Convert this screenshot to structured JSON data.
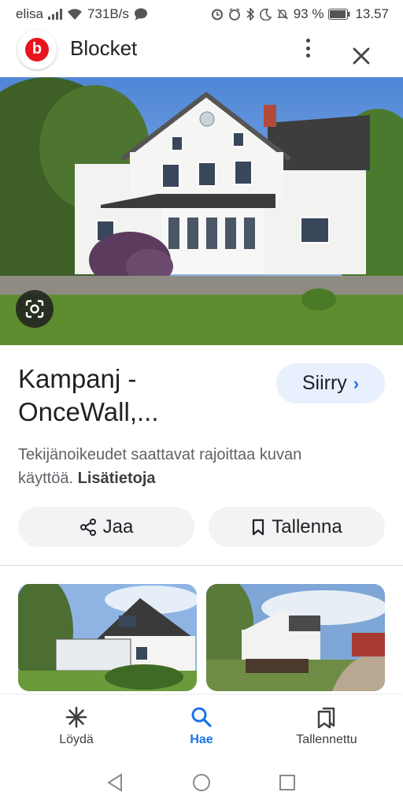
{
  "status_bar": {
    "carrier": "elisa",
    "net_speed": "731B/s",
    "battery": "93 %",
    "time": "13.57"
  },
  "header": {
    "logo_letter": "b",
    "title": "Blocket",
    "brand_color": "#e8141e"
  },
  "result": {
    "title": "Kampanj - OnceWall,...",
    "visit_label": "Siirry",
    "copyright_text": "Tekijänoikeudet saattavat rajoittaa kuvan käyttöä.",
    "more_info_link": "Lisätietoja"
  },
  "actions": {
    "share_label": "Jaa",
    "save_label": "Tallenna"
  },
  "bottom_nav": {
    "items": [
      {
        "label": "Löydä",
        "icon": "asterisk-icon",
        "active": false
      },
      {
        "label": "Hae",
        "icon": "search-icon",
        "active": true
      },
      {
        "label": "Tallennettu",
        "icon": "bookmarks-icon",
        "active": false
      }
    ],
    "accent": "#1a73e8"
  },
  "icons": [
    "signal-icon",
    "wifi-icon",
    "chat-icon",
    "alarm-icon",
    "bluetooth-icon",
    "moon-icon",
    "mute-icon",
    "battery-icon",
    "kebab-menu-icon",
    "close-icon",
    "lens-icon",
    "share-icon",
    "bookmark-icon",
    "chevron-right-icon"
  ]
}
